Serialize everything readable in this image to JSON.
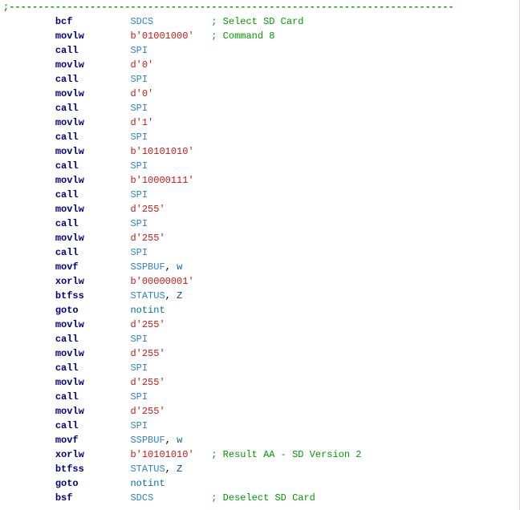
{
  "dashline": ";-----------------------------------------------------------------------------",
  "indent": "         ",
  "col1width": 13,
  "col2width": 14,
  "lines": [
    {
      "mn": "bcf",
      "op": {
        "text": "SDCS",
        "cls": "op-ident"
      },
      "comment": "; Select SD Card"
    },
    {
      "mn": "movlw",
      "op": {
        "text": "b'01001000'",
        "cls": "op-lit"
      },
      "comment": "; Command 8"
    },
    {
      "mn": "call",
      "op": {
        "text": "SPI",
        "cls": "op-ident"
      }
    },
    {
      "mn": "movlw",
      "op": {
        "text": "d'0'",
        "cls": "op-lit"
      }
    },
    {
      "mn": "call",
      "op": {
        "text": "SPI",
        "cls": "op-ident"
      }
    },
    {
      "mn": "movlw",
      "op": {
        "text": "d'0'",
        "cls": "op-lit"
      }
    },
    {
      "mn": "call",
      "op": {
        "text": "SPI",
        "cls": "op-ident"
      }
    },
    {
      "mn": "movlw",
      "op": {
        "text": "d'1'",
        "cls": "op-lit"
      }
    },
    {
      "mn": "call",
      "op": {
        "text": "SPI",
        "cls": "op-ident"
      }
    },
    {
      "mn": "movlw",
      "op": {
        "text": "b'10101010'",
        "cls": "op-lit"
      }
    },
    {
      "mn": "call",
      "op": {
        "text": "SPI",
        "cls": "op-ident"
      }
    },
    {
      "mn": "movlw",
      "op": {
        "text": "b'10000111'",
        "cls": "op-lit"
      }
    },
    {
      "mn": "call",
      "op": {
        "text": "SPI",
        "cls": "op-ident"
      }
    },
    {
      "mn": "movlw",
      "op": {
        "text": "d'255'",
        "cls": "op-lit"
      }
    },
    {
      "mn": "call",
      "op": {
        "text": "SPI",
        "cls": "op-ident"
      }
    },
    {
      "mn": "movlw",
      "op": {
        "text": "d'255'",
        "cls": "op-lit"
      }
    },
    {
      "mn": "call",
      "op": {
        "text": "SPI",
        "cls": "op-ident"
      }
    },
    {
      "mn": "movf",
      "op": {
        "text": "SSPBUF",
        "cls": "op-ident"
      },
      "suffix": ", ",
      "suffix2": {
        "text": "w",
        "cls": "op-low"
      }
    },
    {
      "mn": "xorlw",
      "op": {
        "text": "b'00000001'",
        "cls": "op-lit"
      }
    },
    {
      "mn": "btfss",
      "op": {
        "text": "STATUS",
        "cls": "op-ident"
      },
      "suffix": ", ",
      "suffix2": {
        "text": "Z",
        "cls": "op-flag"
      }
    },
    {
      "mn": "goto",
      "op": {
        "text": "notint",
        "cls": "op-low"
      }
    },
    {
      "mn": "movlw",
      "op": {
        "text": "d'255'",
        "cls": "op-lit"
      }
    },
    {
      "mn": "call",
      "op": {
        "text": "SPI",
        "cls": "op-ident"
      }
    },
    {
      "mn": "movlw",
      "op": {
        "text": "d'255'",
        "cls": "op-lit"
      }
    },
    {
      "mn": "call",
      "op": {
        "text": "SPI",
        "cls": "op-ident"
      }
    },
    {
      "mn": "movlw",
      "op": {
        "text": "d'255'",
        "cls": "op-lit"
      }
    },
    {
      "mn": "call",
      "op": {
        "text": "SPI",
        "cls": "op-ident"
      }
    },
    {
      "mn": "movlw",
      "op": {
        "text": "d'255'",
        "cls": "op-lit"
      }
    },
    {
      "mn": "call",
      "op": {
        "text": "SPI",
        "cls": "op-ident"
      }
    },
    {
      "mn": "movf",
      "op": {
        "text": "SSPBUF",
        "cls": "op-ident"
      },
      "suffix": ", ",
      "suffix2": {
        "text": "w",
        "cls": "op-low"
      }
    },
    {
      "mn": "xorlw",
      "op": {
        "text": "b'10101010'",
        "cls": "op-lit"
      },
      "comment": "; Result AA - SD Version 2"
    },
    {
      "mn": "btfss",
      "op": {
        "text": "STATUS",
        "cls": "op-ident"
      },
      "suffix": ", ",
      "suffix2": {
        "text": "Z",
        "cls": "op-flag"
      }
    },
    {
      "mn": "goto",
      "op": {
        "text": "notint",
        "cls": "op-low"
      }
    },
    {
      "mn": "bsf",
      "op": {
        "text": "SDCS",
        "cls": "op-ident"
      },
      "comment": "; Deselect SD Card"
    }
  ]
}
